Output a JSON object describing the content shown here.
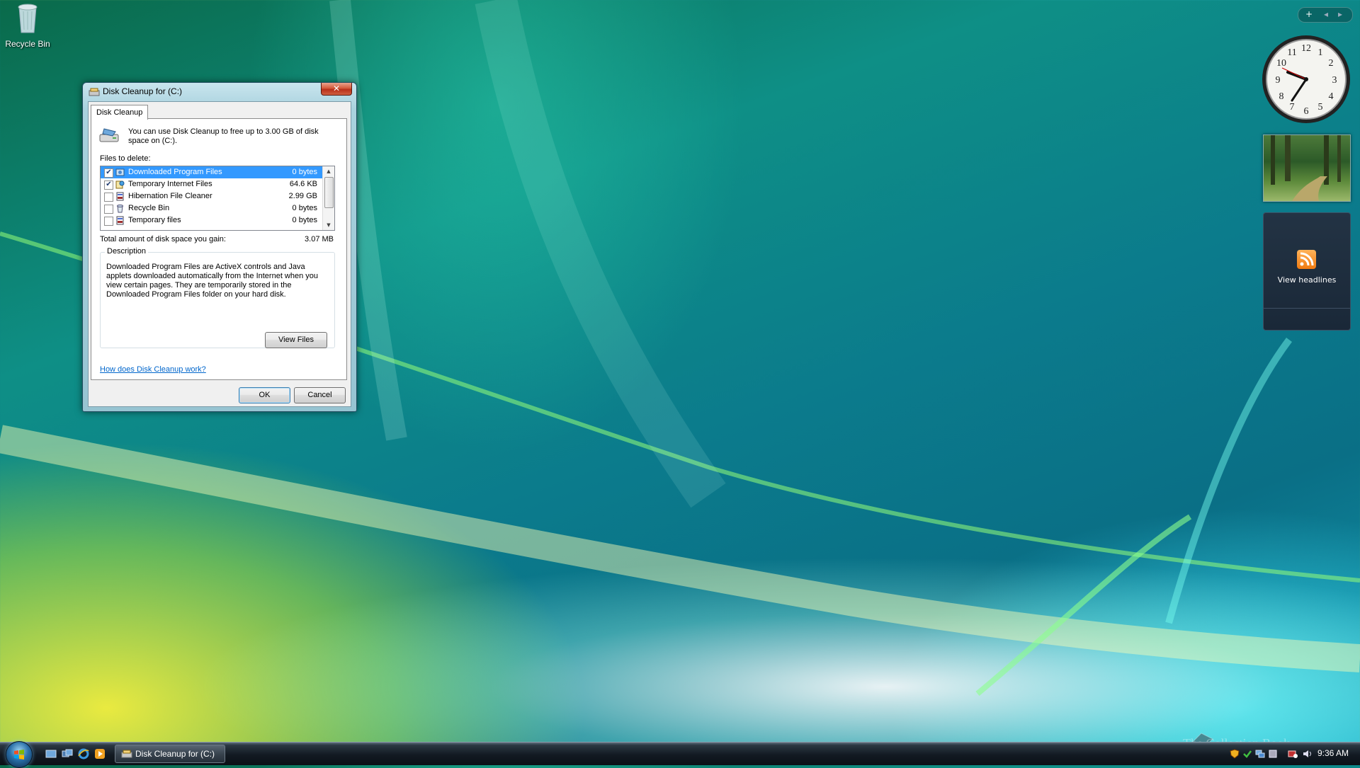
{
  "desktop": {
    "icons": [
      {
        "label": "Recycle Bin",
        "icon": "recycle-bin-icon"
      }
    ]
  },
  "dialog": {
    "title": "Disk Cleanup for  (C:)",
    "close_glyph": "✕",
    "tab": "Disk Cleanup",
    "intro": "You can use Disk Cleanup to free up to 3.00 GB of disk space on  (C:).",
    "files_label": "Files to delete:",
    "files": [
      {
        "name": "Downloaded Program Files",
        "size": "0 bytes",
        "checked": true,
        "selected": true,
        "check_glyph": "✔"
      },
      {
        "name": "Temporary Internet Files",
        "size": "64.6 KB",
        "checked": true,
        "selected": false,
        "check_glyph": "✔"
      },
      {
        "name": "Hibernation File Cleaner",
        "size": "2.99 GB",
        "checked": false,
        "selected": false,
        "check_glyph": ""
      },
      {
        "name": "Recycle Bin",
        "size": "0 bytes",
        "checked": false,
        "selected": false,
        "check_glyph": ""
      },
      {
        "name": "Temporary files",
        "size": "0 bytes",
        "checked": false,
        "selected": false,
        "check_glyph": ""
      }
    ],
    "scroll_up_glyph": "▲",
    "scroll_down_glyph": "▼",
    "total_label": "Total amount of disk space you gain:",
    "total_value": "3.07 MB",
    "description_legend": "Description",
    "description": "Downloaded Program Files are ActiveX controls and Java applets downloaded automatically from the Internet when you view certain pages. They are temporarily stored in the Downloaded Program Files folder on your hard disk.",
    "view_files_button": "View Files",
    "help_link": "How does Disk Cleanup work?",
    "ok_button": "OK",
    "cancel_button": "Cancel"
  },
  "sidebar": {
    "controls": {
      "add": "+",
      "prev": "◂",
      "next": "▸"
    },
    "feed_label": "View headlines"
  },
  "taskbar": {
    "task_button": "Disk Cleanup for  (C:)",
    "time": "9:36 AM"
  },
  "watermark": "The Collection Book",
  "colors": {
    "selection": "#3399ff",
    "link": "#0066cc",
    "close_button": "#c8442a"
  }
}
